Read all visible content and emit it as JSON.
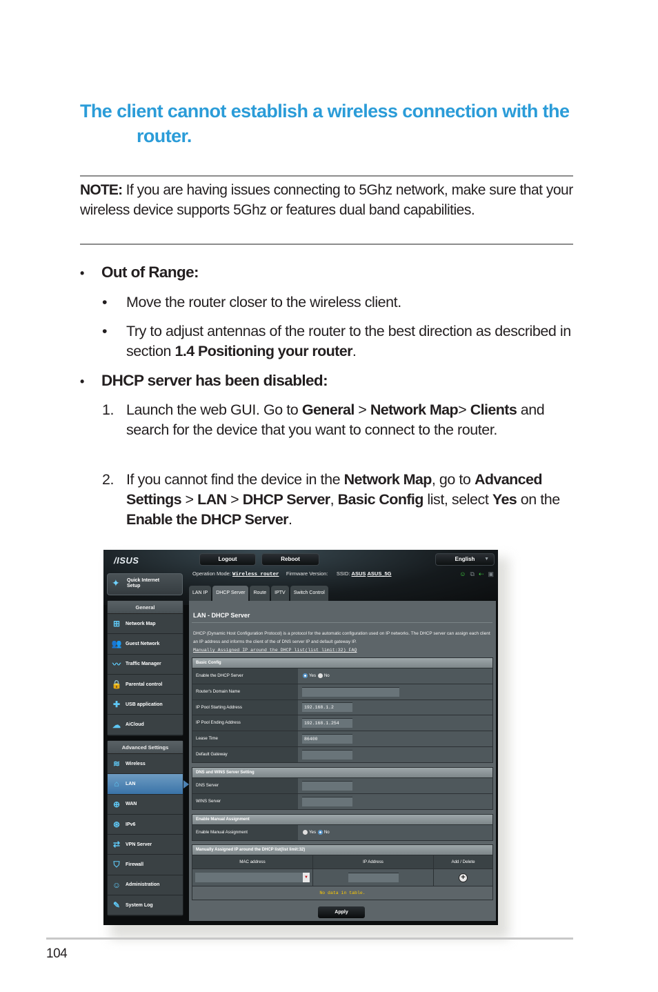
{
  "title": {
    "line1": "The client cannot establish a wireless connection with the",
    "line2": "router."
  },
  "note": {
    "label": "NOTE:",
    "text": " If you are having issues connecting to 5Ghz network, make sure that your wireless device supports 5Ghz or features dual band capabilities."
  },
  "sections": [
    {
      "bullet": "•",
      "heading": "Out of Range:",
      "items": [
        {
          "mark": "•",
          "text": "Move the router closer to the wireless client."
        },
        {
          "mark": "•",
          "text_before": "Try to adjust antennas of the router to the best direction as described in section ",
          "bold": "1.4 Positioning your router",
          "text_after": "."
        }
      ]
    },
    {
      "bullet": "•",
      "heading": "DHCP server has been disabled:",
      "steps": [
        {
          "mark": "1.",
          "p1": "Launch the web GUI. Go to ",
          "b1": "General",
          "p2": " > ",
          "b2": "Network Map",
          "p3": "> ",
          "b3": "Clients",
          "p4": " and search for the device that you want to connect to the router."
        },
        {
          "mark": "2.",
          "p1": "If you cannot find the device in the ",
          "b1": "Network Map",
          "p2": ", go to ",
          "b2": "Advanced Settings",
          "p3": " > ",
          "b3": "LAN",
          "p4": " > ",
          "b4": "DHCP Server",
          "p5": ", ",
          "b5": "Basic Config",
          "p6": " list, select ",
          "b6": "Yes",
          "p7": " on the ",
          "b7": "Enable the DHCP Server",
          "p8": "."
        }
      ]
    }
  ],
  "router_ui": {
    "logo": "/ISUS",
    "logout_label": "Logout",
    "reboot_label": "Reboot",
    "language": "English",
    "operation_mode_label": "Operation Mode:",
    "operation_mode_value": "Wireless router",
    "firmware_label": "Firmware Version:",
    "ssid_label": "SSID:",
    "ssid_1": "ASUS",
    "ssid_2": "ASUS_5G",
    "quick_setup": "Quick Internet Setup",
    "general_header": "General",
    "general_items": [
      {
        "icon": "network-map-icon",
        "glyph": "⊞",
        "label": "Network Map"
      },
      {
        "icon": "guest-network-icon",
        "glyph": "👥",
        "label": "Guest Network"
      },
      {
        "icon": "traffic-manager-icon",
        "glyph": "〰",
        "label": "Traffic Manager"
      },
      {
        "icon": "parental-control-icon",
        "glyph": "🔒",
        "label": "Parental control"
      },
      {
        "icon": "usb-application-icon",
        "glyph": "✚",
        "label": "USB application"
      },
      {
        "icon": "aicloud-icon",
        "glyph": "☁",
        "label": "AiCloud"
      }
    ],
    "advanced_header": "Advanced Settings",
    "advanced_items": [
      {
        "icon": "wireless-icon",
        "glyph": "≋",
        "label": "Wireless"
      },
      {
        "icon": "lan-icon",
        "glyph": "⌂",
        "label": "LAN",
        "active": true
      },
      {
        "icon": "wan-icon",
        "glyph": "⊕",
        "label": "WAN"
      },
      {
        "icon": "ipv6-icon",
        "glyph": "⊛",
        "label": "IPv6"
      },
      {
        "icon": "vpn-server-icon",
        "glyph": "⇄",
        "label": "VPN Server"
      },
      {
        "icon": "firewall-icon",
        "glyph": "⛉",
        "label": "Firewall"
      },
      {
        "icon": "administration-icon",
        "glyph": "☺",
        "label": "Administration"
      },
      {
        "icon": "system-log-icon",
        "glyph": "✎",
        "label": "System Log"
      }
    ],
    "tabs": [
      {
        "label": "LAN IP"
      },
      {
        "label": "DHCP Server",
        "active": true
      },
      {
        "label": "Route"
      },
      {
        "label": "IPTV"
      },
      {
        "label": "Switch Control"
      }
    ],
    "panel_title": "LAN - DHCP Server",
    "panel_desc": "DHCP (Dynamic Host Configuration Protocol) is a protocol for the automatic configuration used on IP networks. The DHCP server can assign each client an IP address and informs the client of the of DNS server IP and default gateway IP.",
    "faq_link": "Manually Assigned IP around the DHCP list(list limit:32) FAQ",
    "basic_config": {
      "header": "Basic Config",
      "enable_dhcp_label": "Enable the DHCP Server",
      "yes_label": "Yes",
      "no_label": "No",
      "enable_dhcp_value": "Yes",
      "domain_name_label": "Router's Domain Name",
      "domain_name_value": "",
      "pool_start_label": "IP Pool Starting Address",
      "pool_start_value": "192.168.1.2",
      "pool_end_label": "IP Pool Ending Address",
      "pool_end_value": "192.168.1.254",
      "lease_time_label": "Lease Time",
      "lease_time_value": "86400",
      "default_gateway_label": "Default Gateway",
      "default_gateway_value": ""
    },
    "dns_wins": {
      "header": "DNS and WINS Server Setting",
      "dns_label": "DNS Server",
      "dns_value": "",
      "wins_label": "WINS Server",
      "wins_value": ""
    },
    "manual_assignment": {
      "header": "Enable Manual Assignment",
      "label": "Enable Manual Assignment",
      "yes_label": "Yes",
      "no_label": "No",
      "value": "No"
    },
    "manual_list": {
      "header": "Manually Assigned IP around the DHCP list(list limit:32)",
      "col_mac": "MAC address",
      "col_ip": "IP Address",
      "col_action": "Add / Delete",
      "empty_text": "No data in table."
    },
    "apply_label": "Apply"
  },
  "colors": {
    "title_blue": "#2b9cd8",
    "router_panel": "#5d6569",
    "router_active_menu": "#3a73a8",
    "no_data_yellow": "#ffcc00"
  },
  "page_number": "104"
}
